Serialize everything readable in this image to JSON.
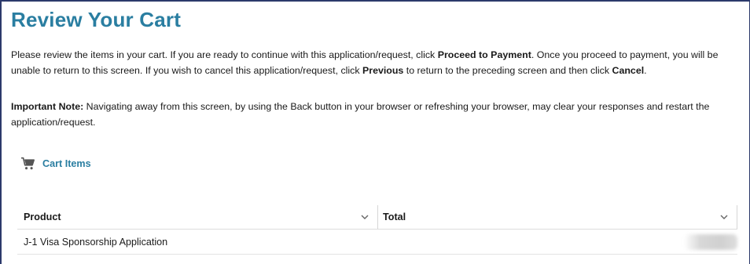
{
  "page": {
    "title": "Review Your Cart"
  },
  "intro": {
    "t1": "Please review the items in your cart. If you are ready to continue with this application/request, click ",
    "b1": "Proceed to Payment",
    "t2": ". Once you proceed to payment, you will be unable to return to this screen. If you wish to cancel this application/request, click ",
    "b2": "Previous",
    "t3": " to return to the preceding screen and then click ",
    "b3": "Cancel",
    "t4": "."
  },
  "note": {
    "label": "Important Note:",
    "text": " Navigating away from this screen, by using the Back button in your browser or refreshing your browser, may clear your responses and restart the application/request."
  },
  "cart": {
    "label": "Cart Items",
    "icon": "cart-icon",
    "columns": [
      "Product",
      "Total"
    ],
    "rows": [
      {
        "product": "J-1 Visa Sponsorship Application",
        "total": ""
      }
    ]
  },
  "colors": {
    "accent": "#2a7ea1",
    "frame": "#2c3a6b"
  }
}
